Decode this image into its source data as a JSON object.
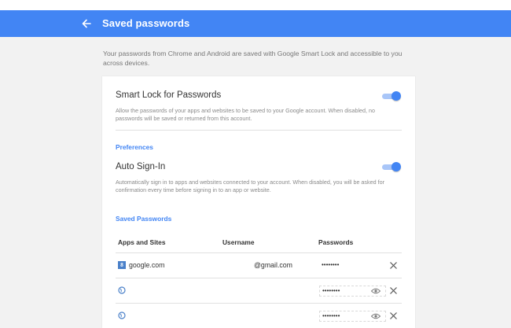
{
  "header": {
    "title": "Saved passwords"
  },
  "intro": "Your passwords from Chrome and Android are saved with Google Smart Lock and accessible to you across devices.",
  "smart_lock": {
    "title": "Smart Lock for Passwords",
    "description": "Allow the passwords of your apps and websites to be saved to your Google account. When disabled, no passwords will be saved or returned from this account.",
    "enabled": true
  },
  "preferences": {
    "section_label": "Preferences",
    "auto_signin": {
      "title": "Auto Sign-In",
      "description": "Automatically sign in to apps and websites connected to your account. When disabled, you will be asked for confirmation every time before signing in to an app or website.",
      "enabled": true
    }
  },
  "saved_passwords": {
    "section_label": "Saved Passwords",
    "columns": {
      "site": "Apps and Sites",
      "username": "Username",
      "password": "Passwords"
    },
    "rows": [
      {
        "site": "google.com",
        "username": "@gmail.com",
        "password": "••••••••",
        "icon": "google-favicon"
      },
      {
        "site": "",
        "username": "",
        "password": "••••••••",
        "icon": "globe-icon"
      },
      {
        "site": "",
        "username": "",
        "password": "••••••••",
        "icon": "globe-icon"
      }
    ]
  },
  "colors": {
    "accent": "#4285f4",
    "background": "#f2f2f2",
    "card": "#ffffff"
  }
}
